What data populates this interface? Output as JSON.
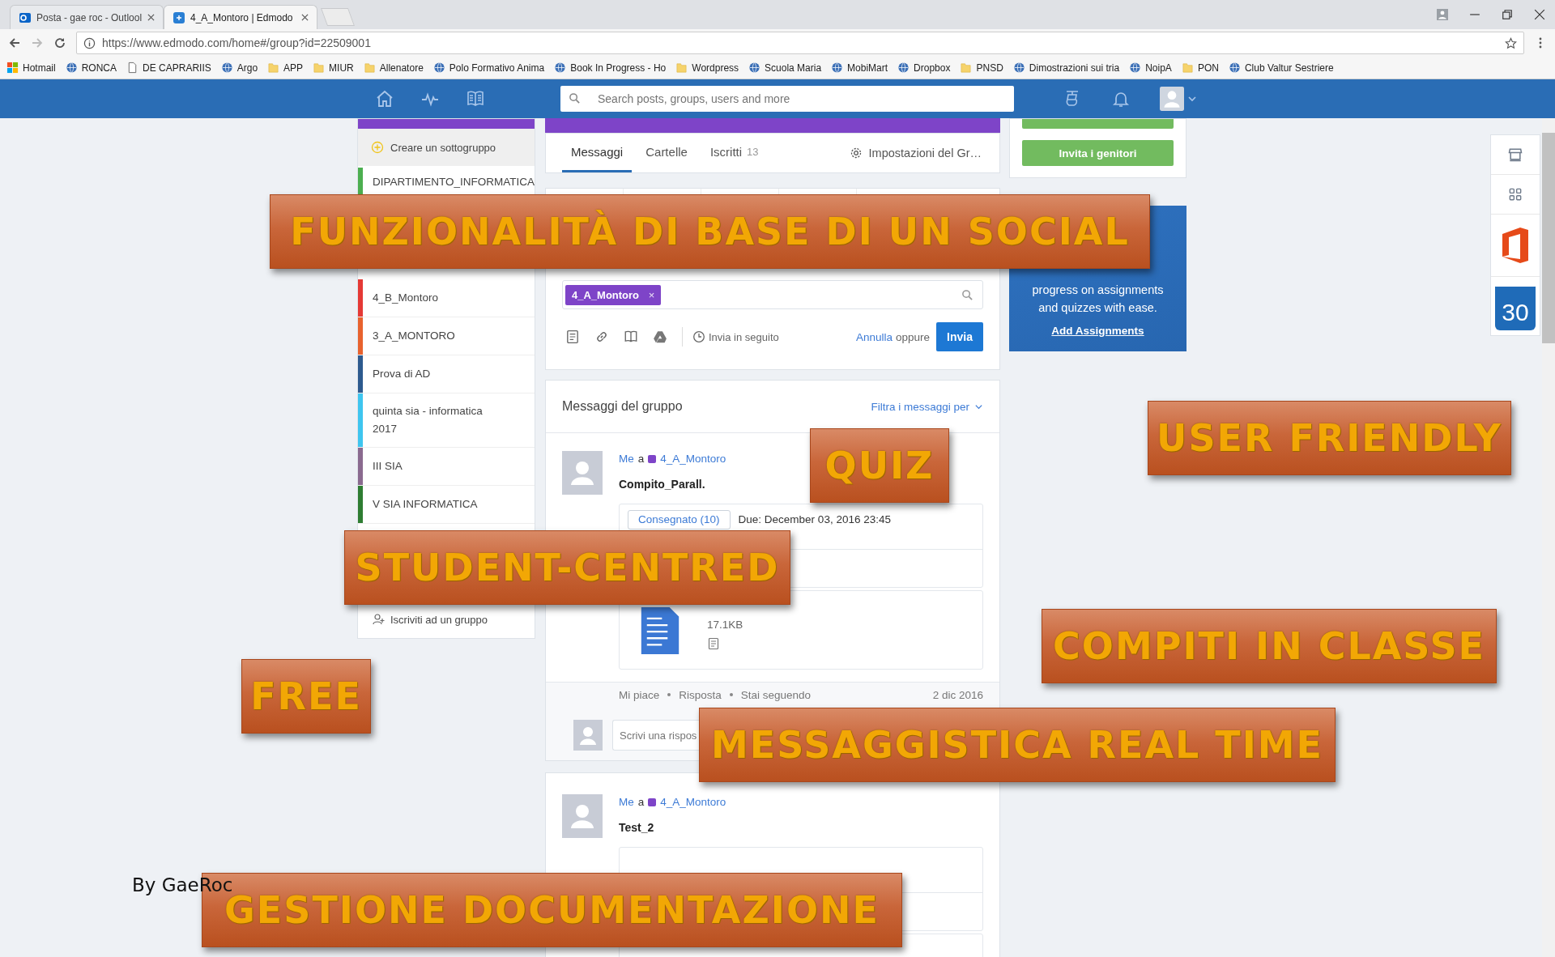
{
  "browser": {
    "tabs": [
      {
        "title": "Posta - gae roc - Outlool",
        "kind": "outlook",
        "selected": false
      },
      {
        "title": "4_A_Montoro | Edmodo",
        "kind": "edmodo",
        "selected": true
      }
    ],
    "url": "https://www.edmodo.com/home#/group?id=22509001",
    "bookmarks": [
      {
        "label": "Hotmail",
        "kind": "windows"
      },
      {
        "label": "RONCA",
        "kind": "site"
      },
      {
        "label": "DE CAPRARIIS",
        "kind": "page"
      },
      {
        "label": "Argo",
        "kind": "site"
      },
      {
        "label": "APP",
        "kind": "folder"
      },
      {
        "label": "MIUR",
        "kind": "folder"
      },
      {
        "label": "Allenatore",
        "kind": "folder"
      },
      {
        "label": "Polo Formativo Anima",
        "kind": "site"
      },
      {
        "label": "Book In Progress - Ho",
        "kind": "site"
      },
      {
        "label": "Wordpress",
        "kind": "folder"
      },
      {
        "label": "Scuola Maria",
        "kind": "site"
      },
      {
        "label": "MobiMart",
        "kind": "site"
      },
      {
        "label": "Dropbox",
        "kind": "site"
      },
      {
        "label": "PNSD",
        "kind": "folder"
      },
      {
        "label": "Dimostrazioni sui tria",
        "kind": "site"
      },
      {
        "label": "NoipA",
        "kind": "site"
      },
      {
        "label": "PON",
        "kind": "folder"
      },
      {
        "label": "Club Valtur Sestriere",
        "kind": "site"
      }
    ]
  },
  "navbar": {
    "search_placeholder": "Search posts, groups, users and more"
  },
  "sidebar": {
    "create": "Creare un sottogruppo",
    "groups": [
      {
        "name": "DIPARTIMENTO_INFORMATICA",
        "color": "#4caf50"
      },
      {
        "name": "4_B_Montoro",
        "color": "#e53935"
      },
      {
        "name": "3_A_MONTORO",
        "color": "#e8622e"
      },
      {
        "name": "Prova di AD",
        "color": "#2d5a8e"
      },
      {
        "name": "quinta sia - informatica 2017",
        "color": "#3ec5ef"
      },
      {
        "name": "III SIA",
        "color": "#8a6a8f"
      },
      {
        "name": "V SIA INFORMATICA",
        "color": "#2e7d32"
      }
    ],
    "join": "Iscriviti ad un gruppo"
  },
  "group_tabs": [
    {
      "label": "Messaggi",
      "selected": true
    },
    {
      "label": "Cartelle",
      "selected": false
    },
    {
      "label": "Iscritti",
      "count": "13",
      "selected": false
    }
  ],
  "settings": "Impostazioni del Gr…",
  "composer": {
    "recipient": "4_A_Montoro",
    "remove": "×",
    "later": "Invia in seguito",
    "cancel": "Annulla",
    "or": "oppure",
    "send": "Invia"
  },
  "feed": {
    "title": "Messaggi del gruppo",
    "filter": "Filtra i messaggi per",
    "posts": [
      {
        "sender": "Me",
        "to": "a",
        "group": "4_A_Montoro",
        "title": "Compito_Parall.",
        "turned_in": "Consegnato (10)",
        "due": "Due: December 03, 2016 23:45",
        "file_size": "17.1KB",
        "actions": [
          "Mi piace",
          "Risposta",
          "Stai seguendo"
        ],
        "date": "2 dic 2016",
        "reply_placeholder": "Scrivi una rispos"
      },
      {
        "sender": "Me",
        "to": "a",
        "group": "4_A_Montoro",
        "title": "Test_2"
      }
    ]
  },
  "right": {
    "invite": "Invita i genitori",
    "promo_text": "progress on assignments and quizzes with ease.",
    "promo_link": "Add Assignments"
  },
  "rail": {
    "calendar_day": "30"
  },
  "banners": [
    "FUNZIONALITÀ DI BASE DI UN SOCIAL",
    "USER FRIENDLY",
    "QUIZ",
    "STUDENT-CENTRED",
    "COMPITI IN CLASSE",
    "FREE",
    "MESSAGGISTICA REAL TIME",
    "GESTIONE DOCUMENTAZIONE"
  ],
  "credit": "By GaeRoc"
}
